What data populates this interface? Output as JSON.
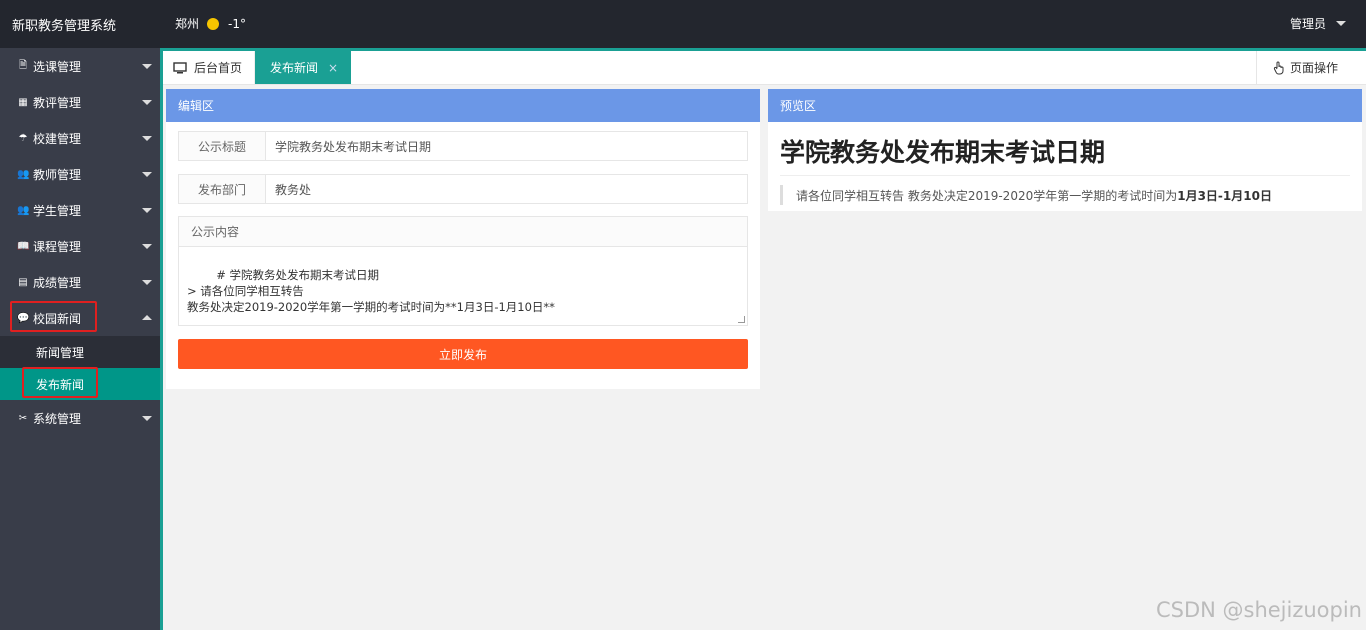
{
  "header": {
    "app_title": "新职教务管理系统",
    "city": "郑州",
    "temperature": "-1°",
    "user": "管理员"
  },
  "sidebar": {
    "items": [
      {
        "label": "选课管理",
        "icon": "document-icon",
        "glyph": "🗎"
      },
      {
        "label": "教评管理",
        "icon": "grid-icon",
        "glyph": "▦"
      },
      {
        "label": "校建管理",
        "icon": "umbrella-icon",
        "glyph": "☂"
      },
      {
        "label": "教师管理",
        "icon": "users-icon",
        "glyph": "👥"
      },
      {
        "label": "学生管理",
        "icon": "users-icon",
        "glyph": "👥"
      },
      {
        "label": "课程管理",
        "icon": "book-icon",
        "glyph": "📖"
      },
      {
        "label": "成绩管理",
        "icon": "form-icon",
        "glyph": "▤"
      },
      {
        "label": "校园新闻",
        "icon": "chat-icon",
        "glyph": "💬"
      },
      {
        "label": "系统管理",
        "icon": "tools-icon",
        "glyph": "✂"
      }
    ],
    "subitems": [
      {
        "label": "新闻管理"
      },
      {
        "label": "发布新闻"
      }
    ]
  },
  "tabs": {
    "home": "后台首页",
    "active": "发布新闻",
    "close": "×",
    "page_ops": "页面操作"
  },
  "editor": {
    "heading": "编辑区",
    "title_label": "公示标题",
    "title_value": "学院教务处发布期末考试日期",
    "dept_label": "发布部门",
    "dept_value": "教务处",
    "content_label": "公示内容",
    "content_value": "# 学院教务处发布期末考试日期\n> 请各位同学相互转告\n教务处决定2019-2020学年第一学期的考试时间为**1月3日-1月10日**",
    "publish_button": "立即发布"
  },
  "preview": {
    "heading": "预览区",
    "title": "学院教务处发布期末考试日期",
    "quote_text": "请各位同学相互转告 教务处决定2019-2020学年第一学期的考试时间为",
    "quote_bold": "1月3日-1月10日"
  },
  "watermark": "CSDN @shejizuopin",
  "colors": {
    "header_bg": "#23262e",
    "sidebar_bg": "#393d49",
    "accent": "#009688",
    "panel_head": "#6b97e7",
    "publish": "#ff5722"
  }
}
